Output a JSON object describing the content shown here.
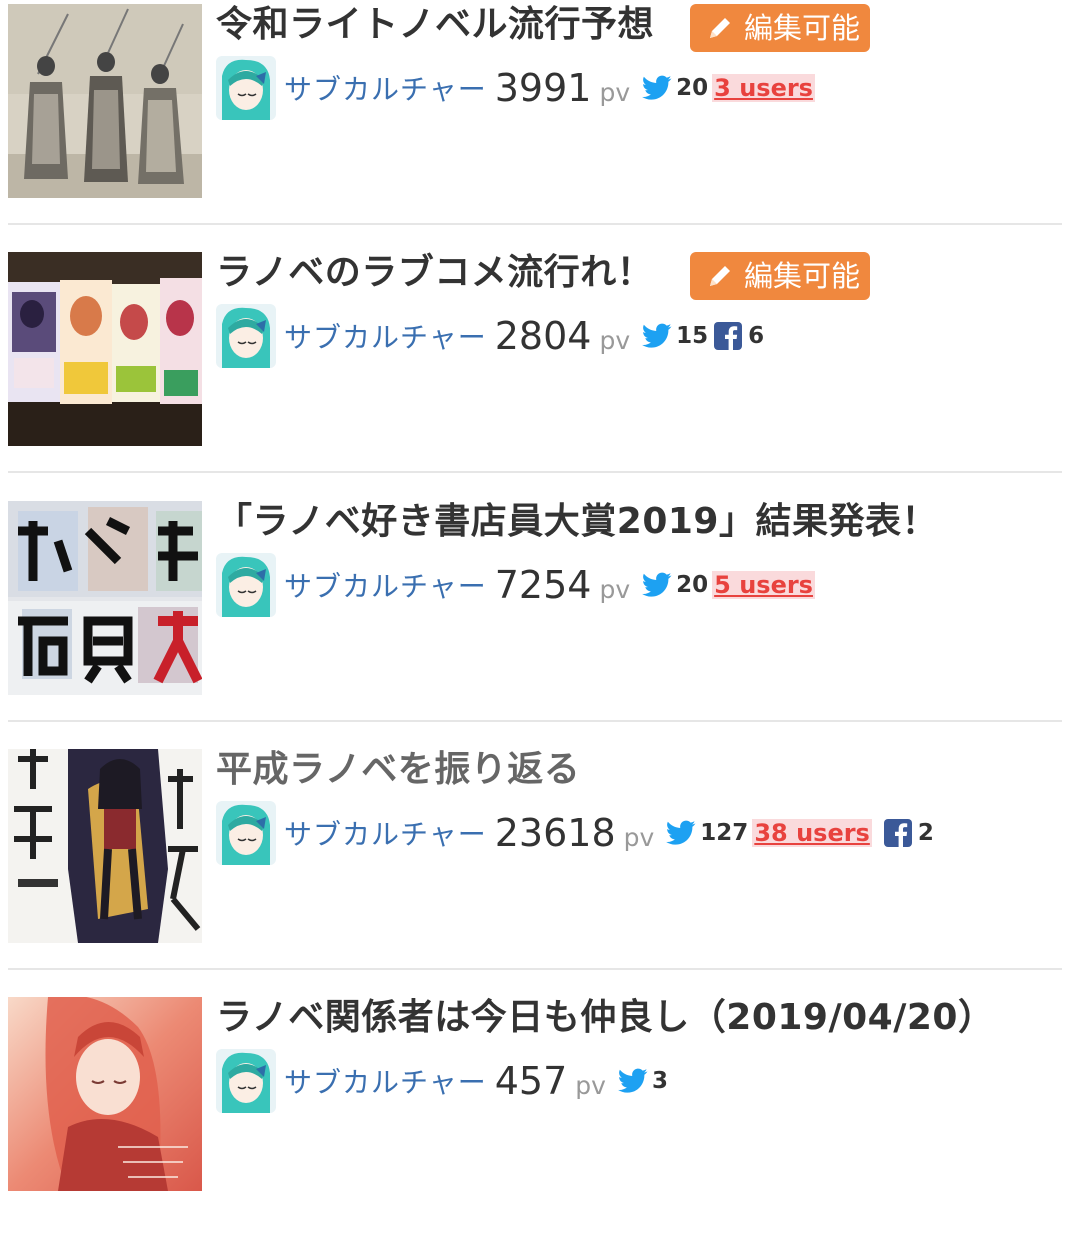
{
  "edit_label": "編集可能",
  "pv_unit": "pv",
  "hatena_suffix": "users",
  "colors": {
    "accent_orange": "#f0883e",
    "link_blue": "#3a6fb0",
    "twitter_blue": "#1da1f2",
    "facebook_blue": "#3b5998",
    "hatena_red": "#e8423e"
  },
  "articles": [
    {
      "title": "令和ライトノベル流行予想",
      "editable": true,
      "category": "サブカルチャー",
      "pv": "3991",
      "tweets": "20",
      "hatena": "3 users",
      "facebook": null,
      "thumb_icon": "vintage-photo-thumbnail"
    },
    {
      "title": "ラノベのラブコメ流行れ！",
      "editable": true,
      "category": "サブカルチャー",
      "pv": "2804",
      "tweets": "15",
      "hatena": null,
      "facebook": "6",
      "thumb_icon": "books-thumbnail"
    },
    {
      "title": "「ラノベ好き書店員大賞2019」結果発表！",
      "editable": false,
      "category": "サブカルチャー",
      "pv": "7254",
      "tweets": "20",
      "hatena": "5 users",
      "facebook": null,
      "thumb_icon": "poster-thumbnail"
    },
    {
      "title": "平成ラノベを振り返る",
      "editable": false,
      "visited": true,
      "category": "サブカルチャー",
      "pv": "23618",
      "tweets": "127",
      "hatena": "38 users",
      "facebook": "2",
      "thumb_icon": "book-cover-thumbnail"
    },
    {
      "title": "ラノベ関係者は今日も仲良し（2019/04/20）",
      "editable": false,
      "category": "サブカルチャー",
      "pv": "457",
      "tweets": "3",
      "hatena": null,
      "facebook": null,
      "thumb_icon": "illustration-thumbnail"
    }
  ]
}
